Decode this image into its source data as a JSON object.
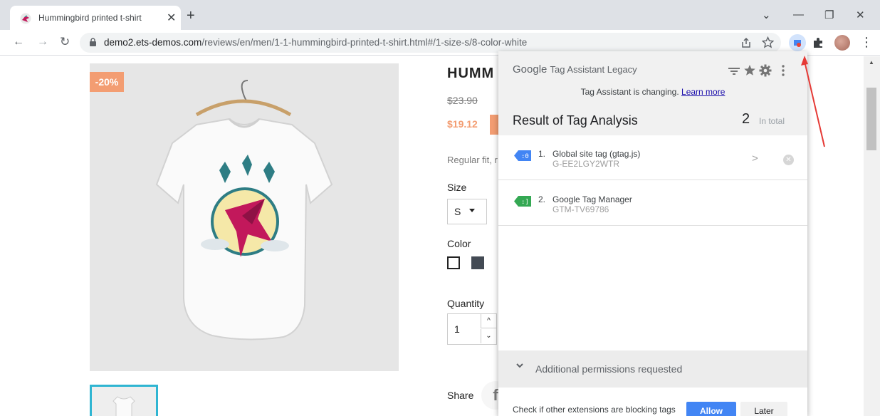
{
  "browser": {
    "tab_title": "Hummingbird printed t-shirt",
    "tab_close": "✕",
    "new_tab": "+",
    "url_host": "demo2.ets-demos.com",
    "url_path": "/reviews/en/men/1-1-hummingbird-printed-t-shirt.html#/1-size-s/8-color-white",
    "win_dropdown": "⌄",
    "win_min": "—",
    "win_restore": "❐",
    "win_close": "✕",
    "back": "←",
    "forward": "→",
    "reload": "↻",
    "menu": "⋮"
  },
  "product": {
    "discount": "-20%",
    "title": "HUMM",
    "old_price": "$23.90",
    "new_price": "$19.12",
    "description": "Regular fit, r",
    "size_label": "Size",
    "size_value": "S",
    "color_label": "Color",
    "quantity_label": "Quantity",
    "quantity_value": "1",
    "qty_up": "^",
    "qty_down": "⌄",
    "share_label": "Share",
    "facebook": "f"
  },
  "tag_assistant": {
    "brand_google": "Google",
    "brand_rest": "Tag Assistant Legacy",
    "changing_text": "Tag Assistant is changing.",
    "learn_more": "Learn more",
    "result_title": "Result of Tag Analysis",
    "count": "2",
    "in_total": "In total",
    "tags": [
      {
        "num": "1.",
        "name": "Global site tag (gtag.js)",
        "id": "G-EE2LGY2WTR",
        "color": "#4285f4"
      },
      {
        "num": "2.",
        "name": "Google Tag Manager",
        "id": "GTM-TV69786",
        "color": "#34a853"
      }
    ],
    "chevron": ">",
    "remove": "✕",
    "permissions_text": "Additional permissions requested",
    "blocking_text": "Check if other extensions are blocking tags",
    "allow": "Allow",
    "later": "Later"
  },
  "colors": {
    "accent": "#f39d72",
    "tag_blue": "#4285f4",
    "tag_green": "#34a853",
    "selected_border": "#2fb5d2",
    "annotation_arrow": "#e53935"
  }
}
